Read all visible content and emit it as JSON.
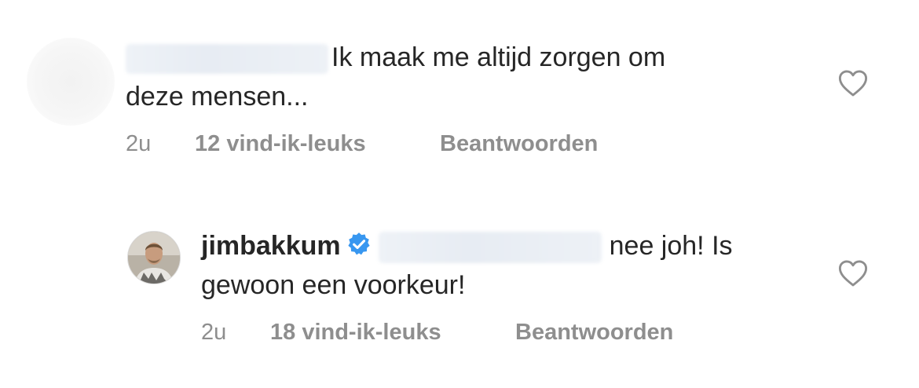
{
  "comments": [
    {
      "username": "",
      "verified": false,
      "mention": "",
      "text_line1": "Ik maak me altijd zorgen om",
      "text_line2": "deze mensen...",
      "time": "2u",
      "likes": "12 vind-ik-leuks",
      "reply_label": "Beantwoorden",
      "like_icon": "heart-outline-icon"
    },
    {
      "username": "jimbakkum",
      "verified": true,
      "mention": "",
      "text_line1": "nee joh! Is",
      "text_line2": "gewoon een voorkeur!",
      "time": "2u",
      "likes": "18 vind-ik-leuks",
      "reply_label": "Beantwoorden",
      "like_icon": "heart-outline-icon"
    }
  ],
  "colors": {
    "text": "#262626",
    "meta": "#8e8e8e",
    "verified_badge": "#3897f0"
  }
}
